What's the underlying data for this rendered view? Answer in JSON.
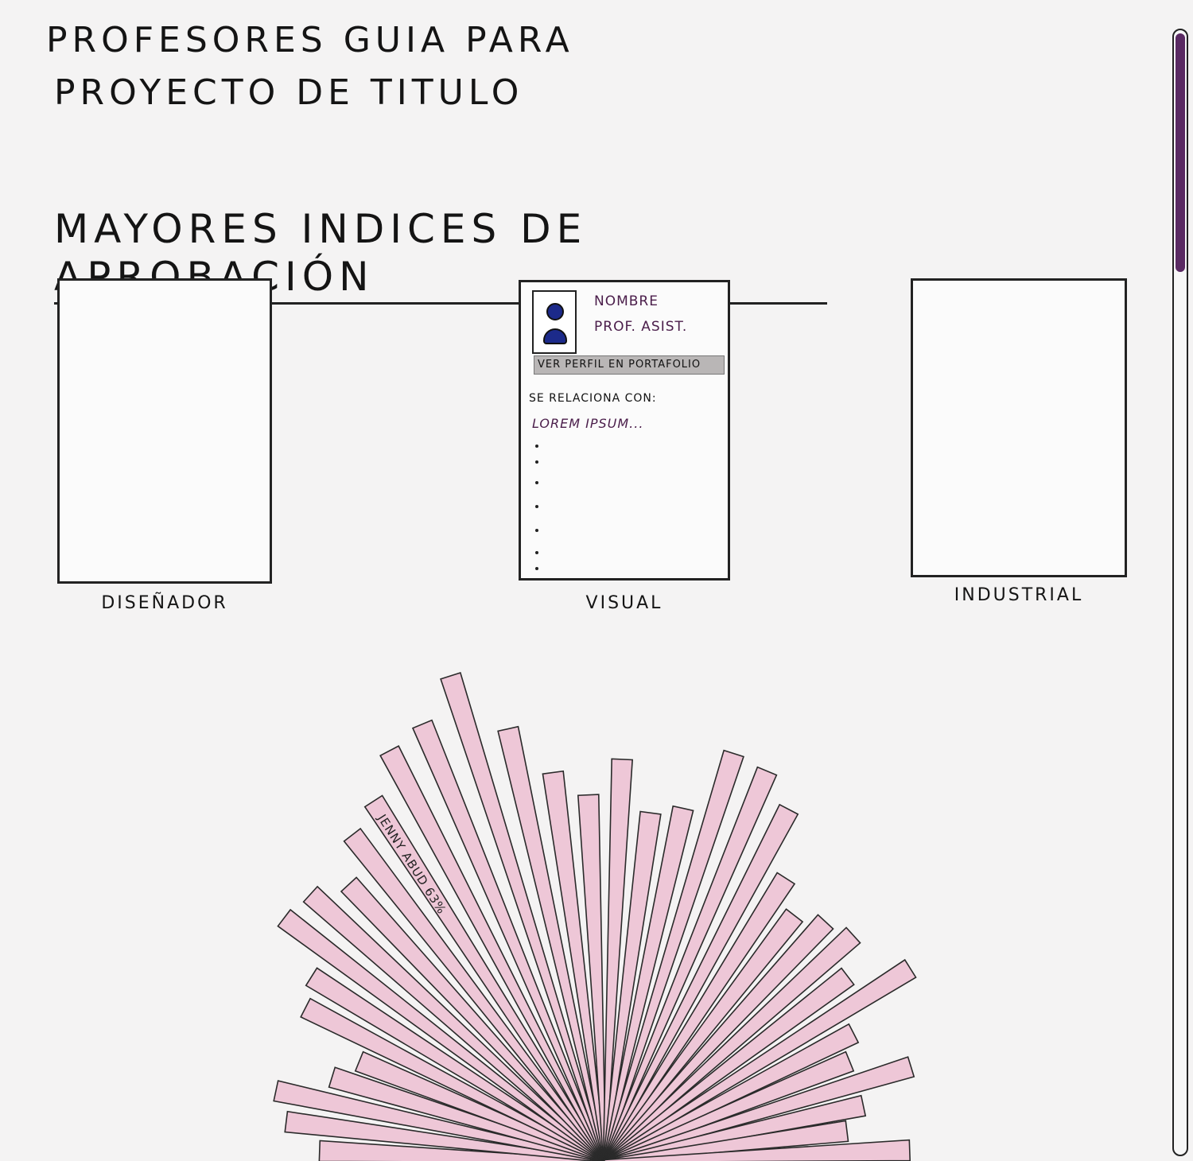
{
  "header": {
    "title_line1": "PROFESORES GUIA PARA",
    "title_line2": "PROYECTO DE TITULO"
  },
  "section": {
    "heading": "MAYORES INDICES DE APROBACIÓN"
  },
  "cards": [
    {
      "label": "DISEÑADOR"
    },
    {
      "label": "VISUAL",
      "name": "NOMBRE",
      "role": "PROF. ASIST.",
      "portfolio_link": "VER PERFIL EN PORTAFOLIO",
      "relates_label": "SE RELACIONA CON:",
      "relates_item": "LOREM IPSUM..."
    },
    {
      "label": "INDUSTRIAL"
    }
  ],
  "chart_data": {
    "type": "bar",
    "layout": "radial-fan",
    "annotation": "JENNY ABUD 63%",
    "bar_color": "#eec7d7",
    "values": [
      0.56,
      0.63,
      0.66,
      0.56,
      0.52,
      0.66,
      0.68,
      0.79,
      0.78,
      0.74,
      0.81,
      0.84,
      0.91,
      0.93,
      1.0,
      0.87,
      0.77,
      0.72,
      0.79,
      0.69,
      0.71,
      0.84,
      0.83,
      0.78,
      0.66,
      0.61,
      0.64,
      0.66,
      0.6,
      0.71,
      0.55,
      0.52,
      0.63,
      0.52,
      0.48,
      0.6
    ]
  },
  "scrollbar": {
    "thumb_color": "#5a2a63"
  }
}
